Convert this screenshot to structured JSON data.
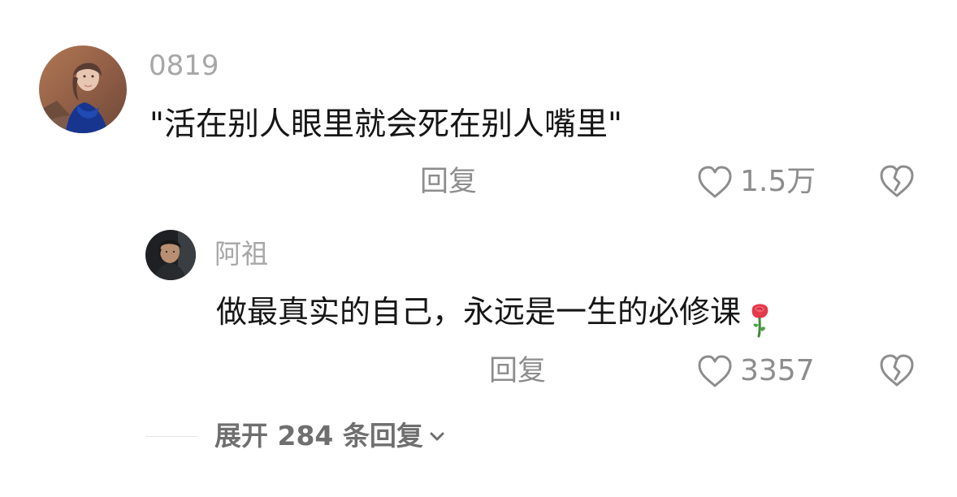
{
  "main_comment": {
    "username": "0819",
    "text": "\"活在别人眼里就会死在别人嘴里\"",
    "reply_label": "回复",
    "likes": "1.5万"
  },
  "reply_comment": {
    "username": "阿祖",
    "text": "做最真实的自己，永远是一生的必修课",
    "emoji": "🌹",
    "reply_label": "回复",
    "likes": "3357"
  },
  "expand": {
    "label": "展开 284 条回复"
  },
  "icons": {
    "like": "heart-outline-icon",
    "dislike": "broken-heart-icon",
    "chevron": "chevron-down-icon",
    "emoji": "rose-icon"
  },
  "colors": {
    "text": "#161616",
    "username": "#a7a7a7",
    "secondary": "#8d8d8d",
    "expand": "#6f6f6f",
    "divider": "#e3e3e3"
  }
}
